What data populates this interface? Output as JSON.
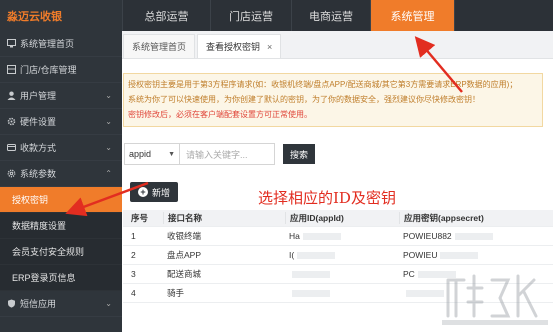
{
  "brand": "淼迈云收银",
  "top_nav": [
    "总部运营",
    "门店运营",
    "电商运营",
    "系统管理"
  ],
  "sidebar": {
    "items": [
      {
        "label": "系统管理首页",
        "icon": "monitor-icon",
        "chevron": ""
      },
      {
        "label": "门店/仓库管理",
        "icon": "store-icon",
        "chevron": ""
      },
      {
        "label": "用户管理",
        "icon": "user-icon",
        "chevron": "⌄"
      },
      {
        "label": "硬件设置",
        "icon": "gear-icon",
        "chevron": "⌄"
      },
      {
        "label": "收款方式",
        "icon": "card-icon",
        "chevron": "⌄"
      },
      {
        "label": "系统参数",
        "icon": "settings-icon",
        "chevron": "⌃"
      }
    ],
    "sub_items": [
      "授权密钥",
      "数据精度设置",
      "会员支付安全规则",
      "ERP登录页信息"
    ],
    "bottom_item": {
      "label": "短信应用",
      "chevron": "⌄"
    }
  },
  "tabs": [
    {
      "label": "系统管理首页"
    },
    {
      "label": "查看授权密钥",
      "close": "×"
    }
  ],
  "notice": [
    "授权密钥主要是用于第3方程序请求(如：收银机终端/盘点APP/配送商城/其它第3方需要请求ERP数据的应用)；",
    "系统为你了可以快速使用，为你创建了默认的密钥，为了你的数据安全，强烈建议你尽快修改密钥！",
    "密钥修改后，必须在客户端配套设置方可正常使用。"
  ],
  "search": {
    "select_value": "appid",
    "placeholder": "请输入关键字...",
    "button": "搜索"
  },
  "add_button": "新增",
  "annotation": "选择相应的ID及密钥",
  "table": {
    "headers": [
      "序号",
      "接口名称",
      "应用ID(appId)",
      "应用密钥(appsecret)"
    ],
    "rows": [
      {
        "no": "1",
        "name": "收银终端",
        "appid": "Ha",
        "secret": "POWIEU882"
      },
      {
        "no": "2",
        "name": "盘点APP",
        "appid": "I(",
        "secret": "POWIEU"
      },
      {
        "no": "3",
        "name": "配送商城",
        "appid": "",
        "secret": "PC"
      },
      {
        "no": "4",
        "name": "骑手",
        "appid": "",
        "secret": ""
      }
    ]
  },
  "colors": {
    "accent": "#f07c2a",
    "dark": "#2f353b",
    "annotation": "#e22d20"
  }
}
